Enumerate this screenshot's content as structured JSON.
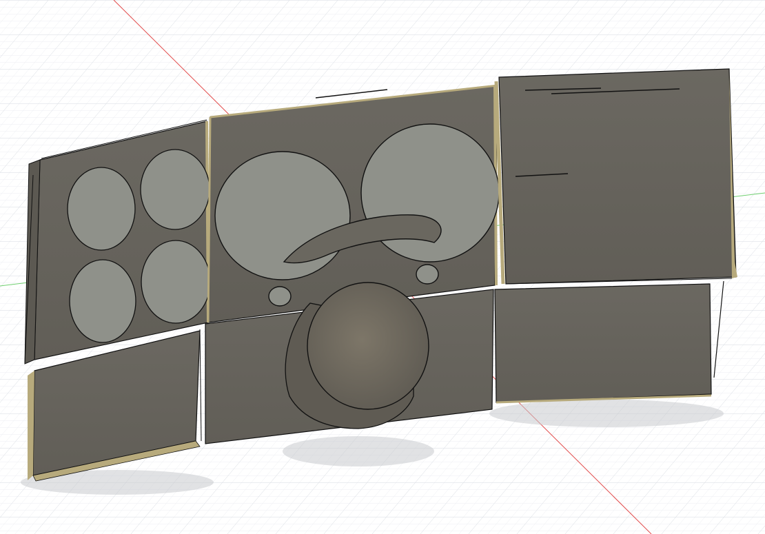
{
  "scene": {
    "background_color": "#ffffff",
    "grid_line_color": "#d9dde3",
    "grid_minor_color": "#eceef2",
    "x_axis_color": "#e24a4a",
    "y_axis_color": "#6fcf6f",
    "panel_face_color": "#6e6b63",
    "panel_shade_color": "#5c5952",
    "panel_edge_color": "#b7aa7c",
    "gauge_face_color": "#8f918a",
    "outline_color": "#111111",
    "shadow_color": "#c9cacd"
  },
  "model": {
    "parts": [
      {
        "name": "left-gauge-panel",
        "gauge_count": 4
      },
      {
        "name": "center-gauge-panel",
        "gauge_count": 2
      },
      {
        "name": "right-upper-panel",
        "gauge_count": 0
      },
      {
        "name": "left-lower-panel",
        "gauge_count": 0
      },
      {
        "name": "center-lower-panel",
        "gauge_count": 0
      },
      {
        "name": "right-lower-panel",
        "gauge_count": 0
      },
      {
        "name": "steering-column-cylinder",
        "gauge_count": 0
      }
    ]
  }
}
